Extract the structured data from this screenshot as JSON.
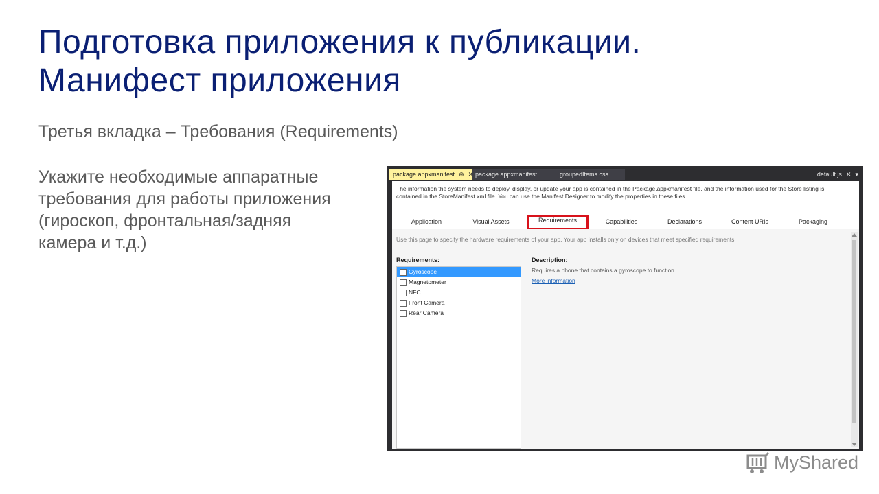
{
  "slide": {
    "title_line1": "Подготовка приложения к публикации.",
    "title_line2": "Манифест приложения",
    "subtitle": "Третья вкладка – Требования (Requirements)",
    "body_lines": [
      "Укажите необходимые аппаратные",
      "требования для работы приложения",
      "(гироскоп, фронтальная/задняя",
      "камера и т.д.)"
    ]
  },
  "editor": {
    "tabs": [
      {
        "label": "package.appxmanifest",
        "pin": "⊕",
        "close": "✕"
      },
      {
        "label": "package.appxmanifest"
      },
      {
        "label": "groupedItems.css"
      }
    ],
    "right_tab": "default.js",
    "right_icons": {
      "close": "✕",
      "dropdown": "▾"
    },
    "info_line1": "The information the system needs to deploy, display, or update your app is contained in the Package.appxmanifest file, and the information used for the Store listing is",
    "info_line2": "contained in the StoreManifest.xml file. You can use the Manifest Designer to modify the properties in these files.",
    "nav_tabs": [
      "Application",
      "Visual Assets",
      "Requirements",
      "Capabilities",
      "Declarations",
      "Content URIs",
      "Packaging"
    ],
    "selected_tab": "Requirements",
    "hint": "Use this page to specify the hardware requirements of your app. Your app installs only on devices that meet specified requirements.",
    "requirements_label": "Requirements:",
    "requirements": [
      "Gyroscope",
      "Magnetometer",
      "NFC",
      "Front Camera",
      "Rear Camera"
    ],
    "selected_requirement": "Gyroscope",
    "description_label": "Description:",
    "description_text": "Requires a phone that contains a gyroscope to function.",
    "more_info": "More information"
  },
  "watermark": {
    "text": "MyShared"
  },
  "colors": {
    "title": "#0a1f73",
    "highlight_border": "#d8121b",
    "active_tab": "#fff29d",
    "selection": "#3399ff"
  }
}
